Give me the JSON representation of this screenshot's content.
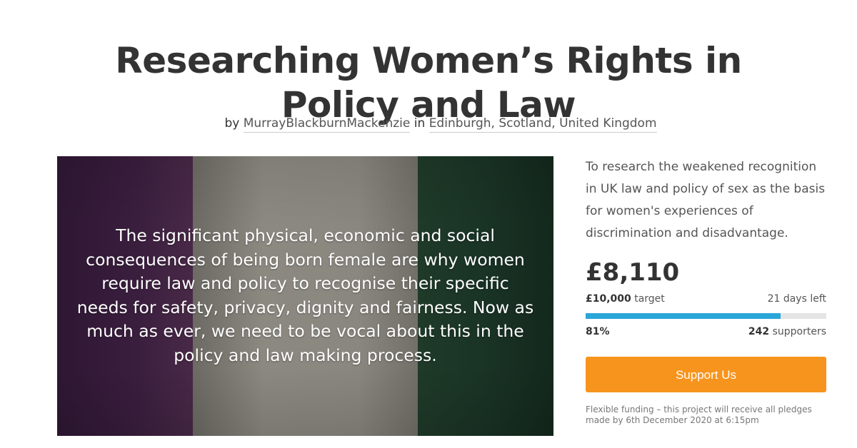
{
  "title": "Researching Women’s Rights in Policy and Law",
  "byline": {
    "by": "by",
    "author": "MurrayBlackburnMackenzie",
    "in": "in",
    "location": "Edinburgh, Scotland, United Kingdom"
  },
  "hero": {
    "quote": "The significant physical, economic and social consequences of being born female are why women require law and policy to recognise their specific needs for safety, privacy, dignity and fairness. Now as much as ever, we need to be vocal about this in the policy and law making process.",
    "colors": {
      "purple": "#3a1e3e",
      "white": "#8c8981",
      "green": "#193325"
    }
  },
  "sidebar": {
    "summary": "To research the weakened recognition in UK law and policy of sex as the basis for women's experiences of discrimination and disadvantage.",
    "raised": "£8,110",
    "target_amount": "£10,000",
    "target_label": "target",
    "days_left": "21 days left",
    "percent": "81%",
    "progress_fraction": 0.81,
    "supporters_count": "242",
    "supporters_label": "supporters",
    "support_button": "Support Us",
    "funding_note": "Flexible funding – this project will receive all pledges made by 6th December 2020 at 6:15pm"
  },
  "colors": {
    "accent_button": "#f7941d",
    "progress": "#2ba6d9",
    "progress_track": "#e5e5e5"
  }
}
